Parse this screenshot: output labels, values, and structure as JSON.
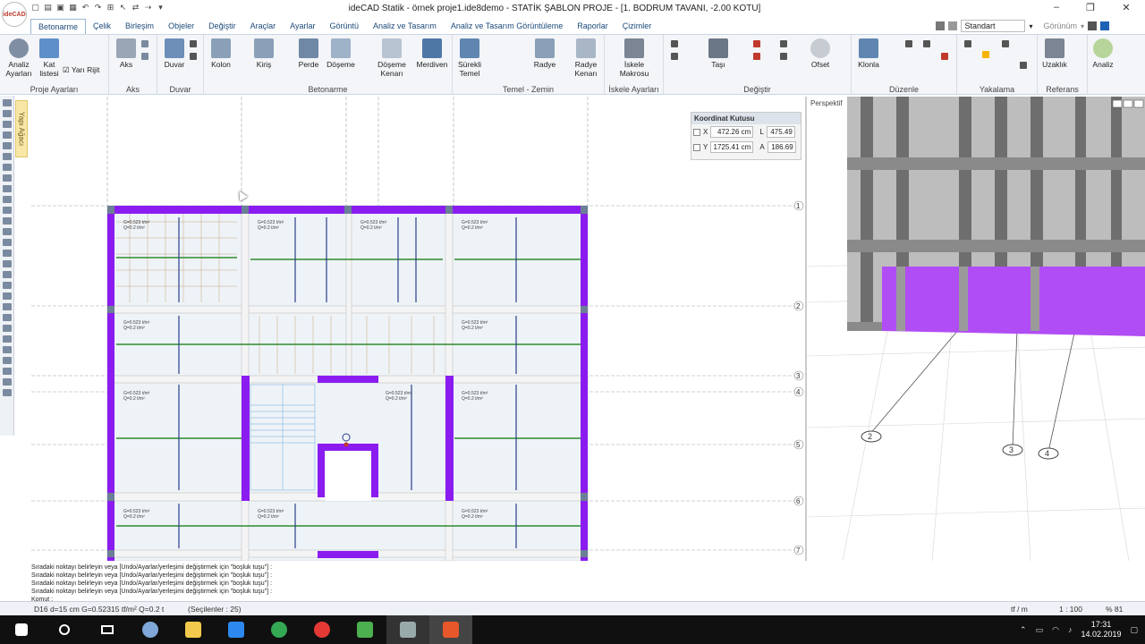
{
  "app": {
    "logo_text": "ideCAD",
    "title": "ideCAD Statik - örnek proje1.ide8demo - STATİK ŞABLON PROJE - [1. BODRUM TAVANI, -2.00 KOTU]",
    "window_controls": [
      "–",
      "❐",
      "✕"
    ]
  },
  "tabs": [
    {
      "label": "Betonarme",
      "active": true
    },
    {
      "label": "Çelik"
    },
    {
      "label": "Birleşim"
    },
    {
      "label": "Objeler"
    },
    {
      "label": "Değiştir"
    },
    {
      "label": "Araçlar"
    },
    {
      "label": "Ayarlar"
    },
    {
      "label": "Görüntü"
    },
    {
      "label": "Analiz ve Tasarım"
    },
    {
      "label": "Analiz ve Tasarım Görüntüleme"
    },
    {
      "label": "Raporlar"
    },
    {
      "label": "Çizimler"
    }
  ],
  "right_toolbar": {
    "style_select": "Standart",
    "view_label": "Görünüm"
  },
  "ribbon": {
    "groups": [
      {
        "label": "Proje Ayarları",
        "buttons": [
          "Analiz Ayarları",
          "Kat listesi",
          "Yarı Rijit"
        ]
      },
      {
        "label": "Aks",
        "buttons": [
          "Aks"
        ]
      },
      {
        "label": "Duvar",
        "buttons": [
          "Duvar"
        ]
      },
      {
        "label": "Betonarme",
        "buttons": [
          "Kolon",
          "Kiriş",
          "Perde",
          "Döşeme",
          "Döşeme Kenarı",
          "Merdiven"
        ]
      },
      {
        "label": "Temel - Zemin",
        "buttons": [
          "Sürekli Temel",
          "Radye",
          "Radye Kenarı"
        ]
      },
      {
        "label": "İskele Ayarları",
        "buttons": [
          "İskele Makrosu"
        ]
      },
      {
        "label": "Değiştir",
        "buttons": [
          "Taşı",
          "Ofset"
        ]
      },
      {
        "label": "Düzenle",
        "buttons": [
          "Klonla"
        ]
      },
      {
        "label": "Yakalama",
        "buttons": []
      },
      {
        "label": "Referans",
        "buttons": [
          "Uzaklık"
        ]
      },
      {
        "label": "",
        "buttons": [
          "Analiz"
        ]
      }
    ]
  },
  "side_panel_label": "Yapı Ağacı",
  "perspective_label": "Perspektif",
  "coordinate_box": {
    "title": "Koordinat Kutusu",
    "x_label": "X",
    "x_value": "472.26 cm",
    "y_label": "Y",
    "y_value": "1725.41 cm",
    "l_label": "L",
    "l_value": "475.49",
    "a_label": "A",
    "a_value": "186.69"
  },
  "plan": {
    "axis_labels": [
      "1",
      "2",
      "3",
      "4",
      "5",
      "6",
      "7"
    ],
    "slab_load_text": "G=0.523 t/m²",
    "slab_live_text": "Q=0.2 t/m²"
  },
  "perspective_axes": [
    "2",
    "3",
    "4"
  ],
  "command_lines": [
    "Sıradaki noktayı belirleyin veya [Undo/Ayarlar/yerleşimi değiştirmek için \"boşluk tuşu\"] :",
    "Sıradaki noktayı belirleyin veya [Undo/Ayarlar/yerleşimi değiştirmek için \"boşluk tuşu\"] :",
    "Sıradaki noktayı belirleyin veya [Undo/Ayarlar/yerleşimi değiştirmek için \"boşluk tuşu\"] :",
    "Sıradaki noktayı belirleyin veya [Undo/Ayarlar/yerleşimi değiştirmek için \"boşluk tuşu\"] :",
    "Komut :"
  ],
  "status": {
    "left": "D16 d=15 cm G=0.52315 tf/m² Q=0.2 t",
    "selection": "(Seçilenler : 25)",
    "unit": "tf / m",
    "scale": "1 : 100",
    "zoom": "% 81"
  },
  "taskbar": {
    "time": "17:31",
    "date": "14.02.2019"
  },
  "colors": {
    "wall": "#8b1cf0",
    "accent": "#2b6cb0",
    "ribbon_bg": "#f3f5f8"
  }
}
